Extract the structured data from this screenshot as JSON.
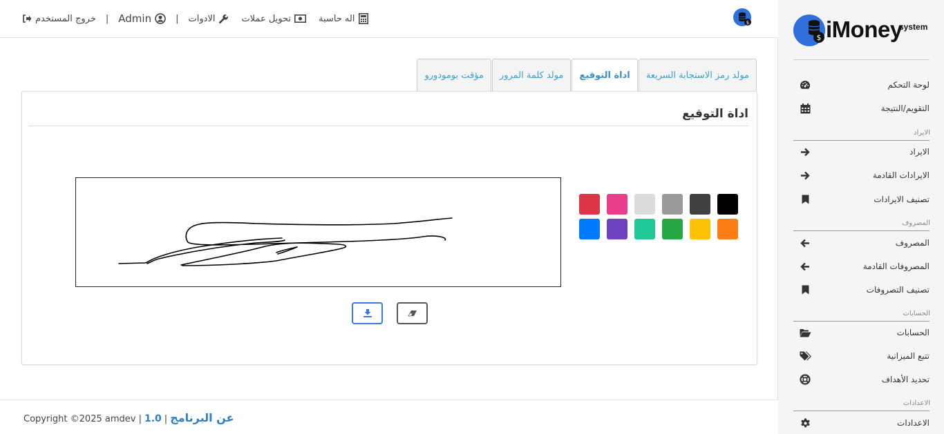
{
  "topbar": {
    "logout": "خروج المستخدم",
    "user": "Admin",
    "tools": "الادوات",
    "currency": "تحويل عملات",
    "calculator": "اله حاسبة",
    "separator": "|"
  },
  "tabs": [
    {
      "label": "مولد رمز الاستجابة السريعة",
      "active": false
    },
    {
      "label": "اداة التوقيع",
      "active": true
    },
    {
      "label": "مولد كلمة المرور",
      "active": false
    },
    {
      "label": "مؤقت بومودورو",
      "active": false
    }
  ],
  "panel": {
    "title": "اداة التوقيع"
  },
  "swatches": [
    "#000000",
    "#404040",
    "#999999",
    "#dcdcdc",
    "#e83e8c",
    "#dc3545",
    "#fd7e14",
    "#ffc107",
    "#28a745",
    "#20c997",
    "#6f42c1",
    "#007bff"
  ],
  "footer": {
    "copyright": "Copyright ©2025 amdev |",
    "version": "1.0",
    "pipe": "|",
    "about": "عن البرنامج"
  },
  "brand": {
    "name": "iMoney",
    "suffix": "system"
  },
  "sidebar": {
    "top_items": [
      {
        "label": "لوحة التحكم",
        "icon": "dashboard-icon"
      },
      {
        "label": "التقويم/النتيجة",
        "icon": "calendar-icon"
      }
    ],
    "sections": [
      {
        "title": "الايراد",
        "items": [
          {
            "label": "الايراد",
            "icon": "arrow-right-icon"
          },
          {
            "label": "الايرادات القادمة",
            "icon": "arrow-right-icon"
          },
          {
            "label": "تصنيف الايرادات",
            "icon": "bookmark-icon"
          }
        ]
      },
      {
        "title": "المصروف",
        "items": [
          {
            "label": "المصروف",
            "icon": "arrow-left-icon"
          },
          {
            "label": "المصروفات القادمة",
            "icon": "arrow-left-icon"
          },
          {
            "label": "تصنيف التصروفات",
            "icon": "bookmark-icon"
          }
        ]
      },
      {
        "title": "الحسابات",
        "items": [
          {
            "label": "الحسابات",
            "icon": "folder-open-icon"
          },
          {
            "label": "تتبع الميزانية",
            "icon": "tags-icon"
          },
          {
            "label": "تحديد الأهداف",
            "icon": "life-ring-icon"
          }
        ]
      },
      {
        "title": "الاعدادات",
        "items": [
          {
            "label": "الاعدادات",
            "icon": "gear-icon"
          }
        ]
      }
    ]
  }
}
